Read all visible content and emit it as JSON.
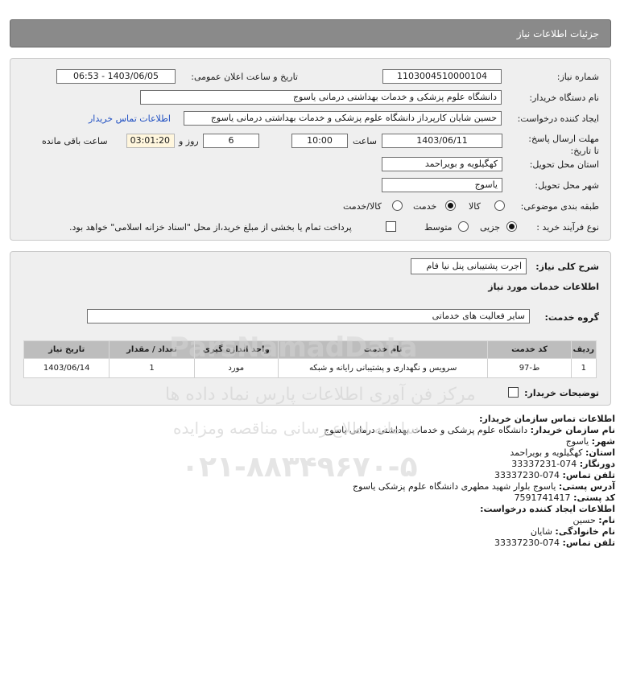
{
  "page": {
    "title": "جزئیات اطلاعات نیاز"
  },
  "fields": {
    "need_number_label": "شماره نیاز:",
    "need_number": "1103004510000104",
    "announce_label": "تاریخ و ساعت اعلان عمومی:",
    "announce_value": "1403/06/05 - 06:53",
    "buyer_org_label": "نام دستگاه خریدار:",
    "buyer_org": "دانشگاه علوم پزشکی و خدمات بهداشتی  درمانی یاسوج",
    "creator_label": "ایجاد کننده درخواست:",
    "creator": "حسین شایان کارپرداز دانشگاه علوم پزشکی و خدمات بهداشتی  درمانی یاسوج",
    "contact_link": "اطلاعات تماس خریدار",
    "deadline_label": "مهلت ارسال پاسخ: تا تاریخ:",
    "deadline_date": "1403/06/11",
    "time_label": "ساعت",
    "deadline_time": "10:00",
    "days_value": "6",
    "days_label": "روز و",
    "remaining_time": "03:01:20",
    "remaining_label": "ساعت باقی مانده",
    "province_label": "استان محل تحویل:",
    "province": "کهگیلویه و بویراحمد",
    "city_label": "شهر محل تحویل:",
    "city": "یاسوج",
    "category_label": "طبقه بندی موضوعی:",
    "category_options": [
      "کالا",
      "خدمت",
      "کالا/خدمت"
    ],
    "category_selected": "خدمت",
    "process_label": "نوع فرآیند خرید :",
    "process_options": [
      "جزیی",
      "متوسط"
    ],
    "process_selected": "جزیی",
    "payment_note": "پرداخت تمام یا بخشی از مبلغ خرید،از محل \"اسناد خزانه اسلامی\" خواهد بود."
  },
  "summary": {
    "label": "شرح کلی نیاز:",
    "value": "اجرت پشتیبانی پنل نیا فام",
    "services_heading": "اطلاعات خدمات مورد نیاز",
    "group_label": "گروه خدمت:",
    "group_value": "سایر فعالیت های خدماتی"
  },
  "table": {
    "headers": [
      "ردیف",
      "کد خدمت",
      "نام خدمت",
      "واحد اندازه گیری",
      "تعداد / مقدار",
      "تاریخ نیاز"
    ],
    "rows": [
      [
        "1",
        "ط-97",
        "سرویس و نگهداری و پشتیبانی رایانه و شبکه",
        "مورد",
        "1",
        "1403/06/14"
      ]
    ]
  },
  "buyer_notes_label": "توضیحات خریدار:",
  "contact": {
    "heading": "اطلاعات تماس سازمان خریدار:",
    "org_label": "نام سازمان خریدار:",
    "org_value": "دانشگاه علوم پزشکی و خدمات بهداشتی درمانی یاسوج",
    "city_label": "شهر:",
    "city_value": "یاسوج",
    "province_label": "استان:",
    "province_value": "کهگیلویه و بویراحمد",
    "fax_label": "دورنگار:",
    "fax_value": "074-33337231",
    "phone_label": "تلفن تماس:",
    "phone_value": "074-33337230",
    "address_label": "آدرس پستی:",
    "address_value": "یاسوج بلوار شهید مطهری دانشگاه علوم پزشکی یاسوج",
    "postal_label": "کد پستی:",
    "postal_value": "7591741417",
    "creator_heading": "اطلاعات ایجاد کننده درخواست:",
    "first_name_label": "نام:",
    "first_name_value": "حسین",
    "last_name_label": "نام خانوادگی:",
    "last_name_value": "شایان",
    "creator_phone_label": "تلفن تماس:",
    "creator_phone_value": "074-33337230"
  },
  "watermark": {
    "brand": "ParsNamadData",
    "line1": "مرکز فن آوری اطلاعات پارس نماد داده ها",
    "line2": "سامانه اطلاع رسانی مناقصه ومزایده",
    "phone": "۰۲۱-۸۸۳۴۹۶۷۰-۵"
  }
}
